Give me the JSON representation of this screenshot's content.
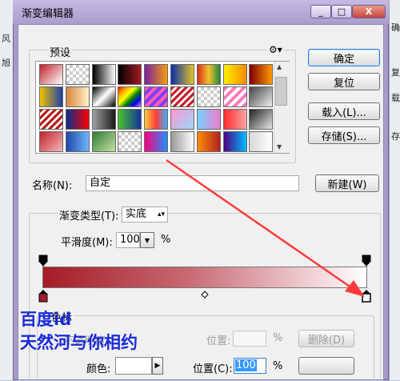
{
  "background": {
    "left_glyphs": [
      "风",
      "旭"
    ],
    "right_glyphs": [
      "确",
      "复",
      "载",
      "存"
    ]
  },
  "window": {
    "title": "渐变编辑器",
    "minimize_label": "_",
    "restore_label": "□",
    "close_label": "X"
  },
  "presets": {
    "label": "预设",
    "gear_glyph": "⚙",
    "menu_arrow": "▾",
    "scroll_up": "▲",
    "scroll_down": "▼"
  },
  "buttons": {
    "ok": "确定",
    "reset": "复位",
    "load": "载入(L)...",
    "save": "存储(S)...",
    "new": "新建(W)",
    "delete": "删除(D)"
  },
  "name": {
    "label": "名称(N):",
    "value": "自定"
  },
  "gradient_type": {
    "label": "渐变类型(T):",
    "value": "实底"
  },
  "smoothness": {
    "label": "平滑度(M):",
    "value": "100",
    "unit": "%"
  },
  "stops": {
    "group_label": "色标",
    "opacity_label": "不透明度:",
    "position_label": "位置:",
    "position_unit": "%",
    "color_label": "颜色:",
    "color_position_label": "位置(C):",
    "color_position_value": "100",
    "color_position_unit": "%"
  },
  "watermark": {
    "line1": "百度id",
    "line2": "天然河与你相约"
  },
  "colors": {
    "accent_red": "#a41c26",
    "arrow_red": "#ff3b3b",
    "watermark_blue": "#1a2ad8"
  }
}
